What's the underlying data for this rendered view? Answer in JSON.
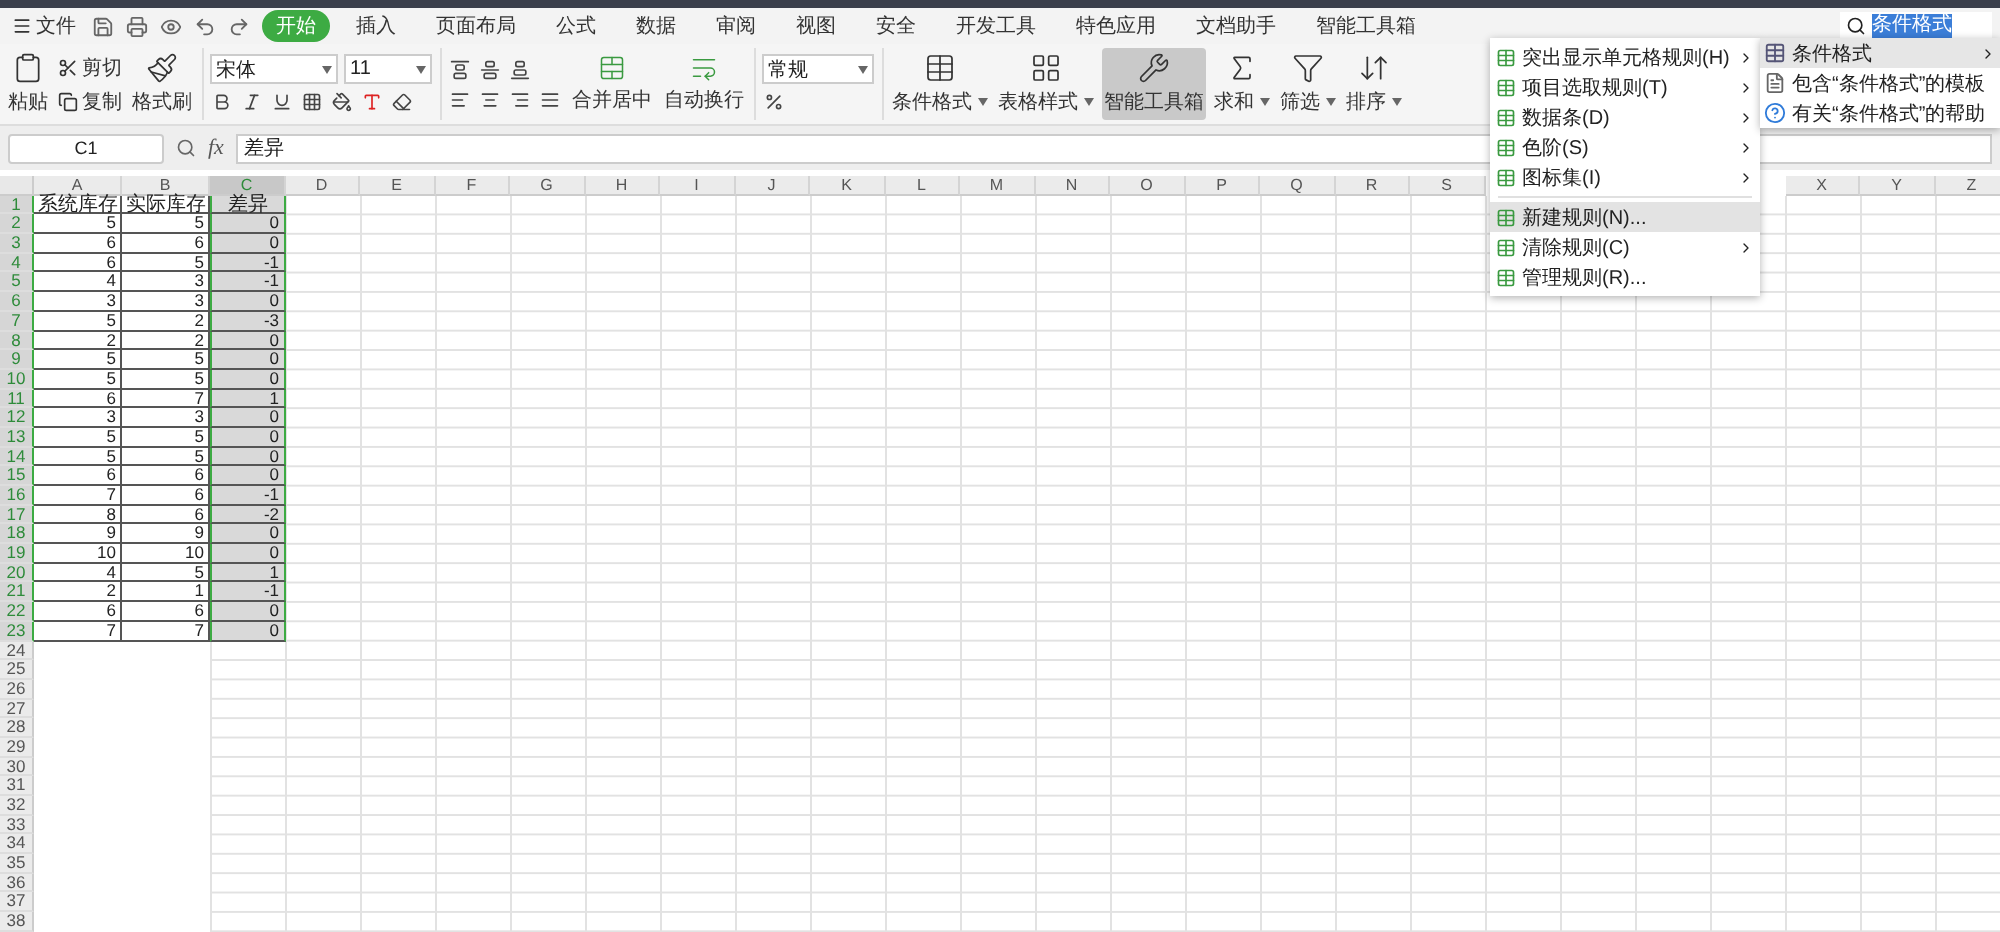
{
  "menu_bar": {
    "file": "文件",
    "tabs": [
      {
        "label": "开始",
        "selected": true
      },
      {
        "label": "插入",
        "selected": false
      },
      {
        "label": "页面布局",
        "selected": false
      },
      {
        "label": "公式",
        "selected": false
      },
      {
        "label": "数据",
        "selected": false
      },
      {
        "label": "审阅",
        "selected": false
      },
      {
        "label": "视图",
        "selected": false
      },
      {
        "label": "安全",
        "selected": false
      },
      {
        "label": "开发工具",
        "selected": false
      },
      {
        "label": "特色应用",
        "selected": false
      },
      {
        "label": "文档助手",
        "selected": false
      },
      {
        "label": "智能工具箱",
        "selected": false
      }
    ],
    "search": {
      "value": "条件格式"
    }
  },
  "ribbon": {
    "paste": "粘贴",
    "cut": "剪切",
    "copy": "复制",
    "format_painter": "格式刷",
    "font_name": "宋体",
    "font_size": "11",
    "merge": "合并居中",
    "wrap": "自动换行",
    "number_format": "常规",
    "tools": [
      {
        "label": "条件格式",
        "kind": "conditional",
        "dropdown": true,
        "selected": false
      },
      {
        "label": "表格样式",
        "kind": "table",
        "dropdown": true,
        "selected": false
      },
      {
        "label": "智能工具箱",
        "kind": "toolbox",
        "dropdown": false,
        "selected": true
      },
      {
        "label": "求和",
        "kind": "sum",
        "dropdown": true,
        "selected": false
      },
      {
        "label": "筛选",
        "kind": "filter",
        "dropdown": true,
        "selected": false
      },
      {
        "label": "排序",
        "kind": "sort",
        "dropdown": true,
        "selected": false
      }
    ]
  },
  "formula_bar": {
    "cell": "C1",
    "fx": "fx",
    "value": "差异"
  },
  "sheet": {
    "columns": [
      {
        "label": "A",
        "selected": false
      },
      {
        "label": "B",
        "selected": false
      },
      {
        "label": "C",
        "selected": true
      },
      {
        "label": "D",
        "selected": false
      },
      {
        "label": "E",
        "selected": false
      },
      {
        "label": "F",
        "selected": false
      },
      {
        "label": "G",
        "selected": false
      },
      {
        "label": "H",
        "selected": false
      },
      {
        "label": "I",
        "selected": false
      },
      {
        "label": "J",
        "selected": false
      },
      {
        "label": "K",
        "selected": false
      },
      {
        "label": "L",
        "selected": false
      },
      {
        "label": "M",
        "selected": false
      },
      {
        "label": "N",
        "selected": false
      },
      {
        "label": "O",
        "selected": false
      },
      {
        "label": "P",
        "selected": false
      },
      {
        "label": "Q",
        "selected": false
      },
      {
        "label": "R",
        "selected": false
      },
      {
        "label": "S",
        "selected": false
      },
      {},
      {},
      {},
      {},
      {
        "label": "X",
        "selected": false
      },
      {
        "label": "Y",
        "selected": false
      },
      {
        "label": "Z",
        "selected": false
      }
    ],
    "rows": [
      {
        "number": "1",
        "selected": true,
        "cells": [
          "系统库存",
          "实际库存",
          "差异"
        ]
      },
      {
        "number": "2",
        "selected": true,
        "cells": [
          "5",
          "5",
          "0"
        ]
      },
      {
        "number": "3",
        "selected": true,
        "cells": [
          "6",
          "6",
          "0"
        ]
      },
      {
        "number": "4",
        "selected": true,
        "cells": [
          "6",
          "5",
          "-1"
        ]
      },
      {
        "number": "5",
        "selected": true,
        "cells": [
          "4",
          "3",
          "-1"
        ]
      },
      {
        "number": "6",
        "selected": true,
        "cells": [
          "3",
          "3",
          "0"
        ]
      },
      {
        "number": "7",
        "selected": true,
        "cells": [
          "5",
          "2",
          "-3"
        ]
      },
      {
        "number": "8",
        "selected": true,
        "cells": [
          "2",
          "2",
          "0"
        ]
      },
      {
        "number": "9",
        "selected": true,
        "cells": [
          "5",
          "5",
          "0"
        ]
      },
      {
        "number": "10",
        "selected": true,
        "cells": [
          "5",
          "5",
          "0"
        ]
      },
      {
        "number": "11",
        "selected": true,
        "cells": [
          "6",
          "7",
          "1"
        ]
      },
      {
        "number": "12",
        "selected": true,
        "cells": [
          "3",
          "3",
          "0"
        ]
      },
      {
        "number": "13",
        "selected": true,
        "cells": [
          "5",
          "5",
          "0"
        ]
      },
      {
        "number": "14",
        "selected": true,
        "cells": [
          "5",
          "5",
          "0"
        ]
      },
      {
        "number": "15",
        "selected": true,
        "cells": [
          "6",
          "6",
          "0"
        ]
      },
      {
        "number": "16",
        "selected": true,
        "cells": [
          "7",
          "6",
          "-1"
        ]
      },
      {
        "number": "17",
        "selected": true,
        "cells": [
          "8",
          "6",
          "-2"
        ]
      },
      {
        "number": "18",
        "selected": true,
        "cells": [
          "9",
          "9",
          "0"
        ]
      },
      {
        "number": "19",
        "selected": true,
        "cells": [
          "10",
          "10",
          "0"
        ]
      },
      {
        "number": "20",
        "selected": true,
        "cells": [
          "4",
          "5",
          "1"
        ]
      },
      {
        "number": "21",
        "selected": true,
        "cells": [
          "2",
          "1",
          "-1"
        ]
      },
      {
        "number": "22",
        "selected": true,
        "cells": [
          "6",
          "6",
          "0"
        ]
      },
      {
        "number": "23",
        "selected": true,
        "cells": [
          "7",
          "7",
          "0"
        ]
      },
      {
        "number": "24",
        "selected": false,
        "cells": []
      },
      {
        "number": "25",
        "selected": false,
        "cells": []
      },
      {
        "number": "26",
        "selected": false,
        "cells": []
      },
      {
        "number": "27",
        "selected": false,
        "cells": []
      },
      {
        "number": "28",
        "selected": false,
        "cells": []
      },
      {
        "number": "29",
        "selected": false,
        "cells": []
      },
      {
        "number": "30",
        "selected": false,
        "cells": []
      },
      {
        "number": "31",
        "selected": false,
        "cells": []
      },
      {
        "number": "32",
        "selected": false,
        "cells": []
      },
      {
        "number": "33",
        "selected": false,
        "cells": []
      },
      {
        "number": "34",
        "selected": false,
        "cells": []
      },
      {
        "number": "35",
        "selected": false,
        "cells": []
      },
      {
        "number": "36",
        "selected": false,
        "cells": []
      },
      {
        "number": "37",
        "selected": false,
        "cells": []
      },
      {
        "number": "38",
        "selected": false,
        "cells": []
      }
    ]
  },
  "dropdown_menu": {
    "items": [
      {
        "label": "突出显示单元格规则(H)",
        "submenu": true,
        "selected": false
      },
      {
        "label": "项目选取规则(T)",
        "submenu": true,
        "selected": false
      },
      {
        "label": "数据条(D)",
        "submenu": true,
        "selected": false
      },
      {
        "label": "色阶(S)",
        "submenu": true,
        "selected": false
      },
      {
        "label": "图标集(I)",
        "submenu": true,
        "selected": false
      },
      {
        "label": "新建规则(N)...",
        "submenu": false,
        "selected": true
      },
      {
        "label": "清除规则(C)",
        "submenu": true,
        "selected": false
      },
      {
        "label": "管理规则(R)...",
        "submenu": false,
        "selected": false
      }
    ]
  },
  "search_results": {
    "items": [
      {
        "label": "条件格式",
        "kind": "command",
        "selected": true
      },
      {
        "label": "包含“条件格式”的模板",
        "kind": "template",
        "selected": false
      },
      {
        "label": "有关“条件格式”的帮助",
        "kind": "help",
        "selected": false
      }
    ]
  }
}
